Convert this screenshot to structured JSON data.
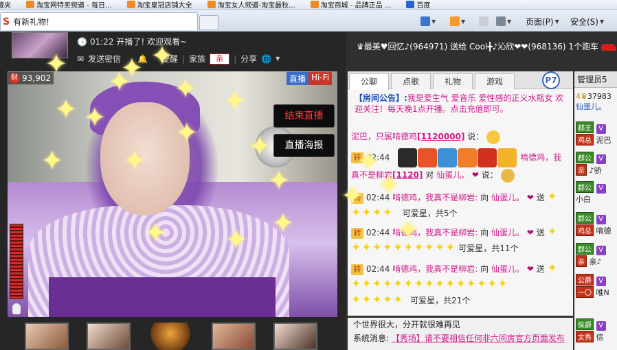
{
  "favorites": [
    {
      "label": "收藏夹",
      "icon": "star-icon"
    },
    {
      "label": "淘宝网特卖频道 - 每日...",
      "icon": "taobao-icon"
    },
    {
      "label": "淘宝皇冠店铺大全",
      "icon": "taobao-icon"
    },
    {
      "label": "淘宝女人频道-淘宝最秋...",
      "icon": "taobao-icon"
    },
    {
      "label": "淘宝商城 - 品牌正品 ...",
      "icon": "taobao-icon"
    },
    {
      "label": "百度",
      "icon": "baidu-icon"
    }
  ],
  "tab": {
    "title": "有新礼物!"
  },
  "commands": {
    "page": "页面(P)",
    "safety": "安全(S)"
  },
  "host": {
    "time_text": "01:22 开播了! 欢迎观看~",
    "send_private": "发送密信",
    "remind": "提醒",
    "family_label": "家族",
    "family_badge": "亲",
    "share": "分享"
  },
  "video": {
    "wealth": "93,902",
    "wealth_icon": "财",
    "live_tag": "直播",
    "hifi_tag": "Hi-Fi",
    "end_live": "结束直播",
    "live_poster": "直播海报"
  },
  "ticker": "♛最美♥回忆♪(964971) 送给 Cool╋♪沁欣❤❤(968136) 1个跑车",
  "chat": {
    "tabs": [
      "公聊",
      "点歌",
      "礼物",
      "游戏"
    ],
    "p_badge": "P7",
    "announce_label": "【房间公告】:",
    "announce_text": "我是爱生气 爱音乐 爱性感的正义水瓶女 欢迎关注！每天晚1点开播。点击充值即可。",
    "messages": [
      {
        "sender": "泥巴，只属啃德鸡",
        "id": "[1120000]",
        "verb": "说："
      },
      {
        "time": "02:44",
        "name": "啃德鸡，我"
      },
      {
        "line2_pre": "真不是柳岩",
        "id": "[1120]",
        "to": "对",
        "target": "仙蛋儿。",
        "verb": "说："
      },
      {
        "turn": "转",
        "time": "02:44",
        "sender": "啃德鸡，我真不是柳岩:",
        "to": "向",
        "target": "仙蛋儿。",
        "action": "送",
        "result": "可爱星，共5个"
      },
      {
        "turn": "转",
        "time": "02:44",
        "sender": "啃德鸡，我真不是柳岩:",
        "to": "向",
        "target": "仙蛋儿。",
        "action": "送",
        "result": "可爱星，共11个"
      },
      {
        "turn": "转",
        "time": "02:44",
        "sender": "啃德鸡，我真不是柳岩:",
        "to": "向",
        "target": "仙蛋儿。",
        "action": "送",
        "result": "可爱星，共21个"
      }
    ],
    "bottom_line": "个世界很大，分开就很难再见",
    "system_label": "系统消息:",
    "system_text": "【秀场】请不要相信任何非六间房官方页面发布"
  },
  "admins": {
    "header": "管理员5",
    "rows": [
      {
        "num": "37983",
        "name": "仙蛋儿。"
      },
      {
        "tag": "郡王",
        "badge": "鸡总",
        "name": "泥巴"
      },
      {
        "tag": "郡公",
        "badge": "亲",
        "name": "♪骄"
      },
      {
        "tag": "郡公",
        "name": "小白"
      },
      {
        "tag": "郡公",
        "badge": "鸡总",
        "name": "啃德"
      },
      {
        "tag": "郡公",
        "badge": "亲",
        "name": "亲♪"
      },
      {
        "tag": "公爵",
        "badge": "一〇",
        "name": "唯N"
      },
      {
        "tag": "侯爵",
        "badge": "文秀",
        "name": "信"
      }
    ]
  },
  "colors": {
    "accent_red": "#d02020",
    "accent_pink": "#d0198c",
    "accent_blue": "#1b50b8"
  }
}
